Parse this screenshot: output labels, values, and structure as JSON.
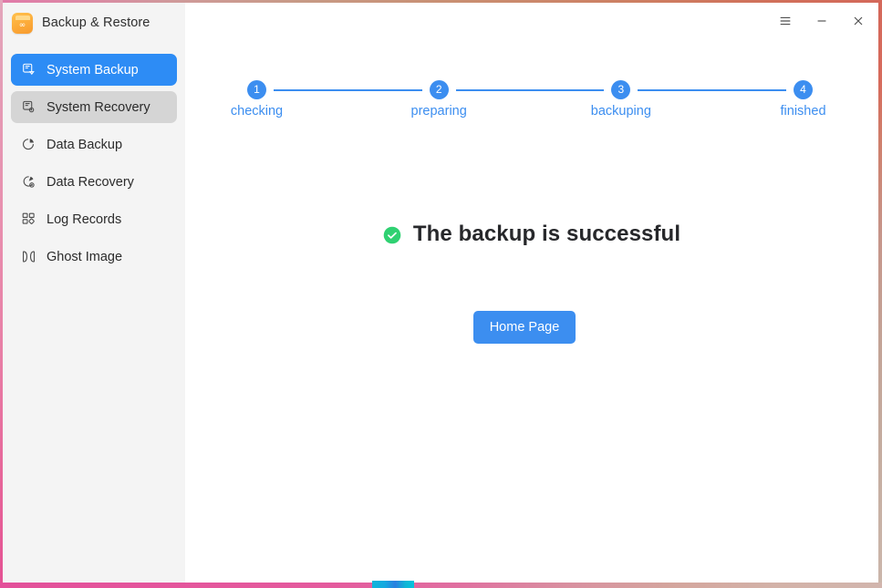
{
  "window": {
    "app_title": "Backup & Restore",
    "app_icon": "backup-app-icon",
    "app_icon_glyph": "∞",
    "controls": [
      {
        "name": "menu-button",
        "icon": "hamburger-menu-icon",
        "label": "Menu"
      },
      {
        "name": "minimize-button",
        "icon": "minimize-icon",
        "label": "Minimize"
      },
      {
        "name": "close-button",
        "icon": "close-icon",
        "label": "Close"
      }
    ],
    "border_colors": {
      "top_start": "#e07aa8",
      "top_end": "#d4685a",
      "left_start": "#e3a6bb",
      "left_end": "#e45193",
      "right_start": "#d4685a",
      "right_end": "#cbb6ab",
      "bottom_start": "#e3509a",
      "bottom_end": "#d2b5ad",
      "bottom_accent": "#14a9e0"
    }
  },
  "sidebar": {
    "background": "#f4f4f4",
    "items": [
      {
        "label": "System Backup",
        "icon": "system-backup-icon",
        "state": "active"
      },
      {
        "label": "System Recovery",
        "icon": "system-recovery-icon",
        "state": "hover"
      },
      {
        "label": "Data Backup",
        "icon": "data-backup-icon",
        "state": "normal"
      },
      {
        "label": "Data Recovery",
        "icon": "data-recovery-icon",
        "state": "normal"
      },
      {
        "label": "Log Records",
        "icon": "log-records-icon",
        "state": "normal"
      },
      {
        "label": "Ghost Image",
        "icon": "ghost-image-icon",
        "state": "normal"
      }
    ],
    "active_color": "#2d8cf5",
    "hover_color": "#d5d5d5"
  },
  "main": {
    "stepper": {
      "accent_color": "#3c8ef0",
      "steps": [
        {
          "number": "1",
          "label": "checking"
        },
        {
          "number": "2",
          "label": "preparing"
        },
        {
          "number": "3",
          "label": "backuping"
        },
        {
          "number": "4",
          "label": "finished"
        }
      ]
    },
    "result": {
      "icon": "success-check-icon",
      "icon_color": "#2fd172",
      "message": "The backup is successful"
    },
    "primary_button": {
      "label": "Home Page",
      "color": "#3c8ef0"
    }
  }
}
